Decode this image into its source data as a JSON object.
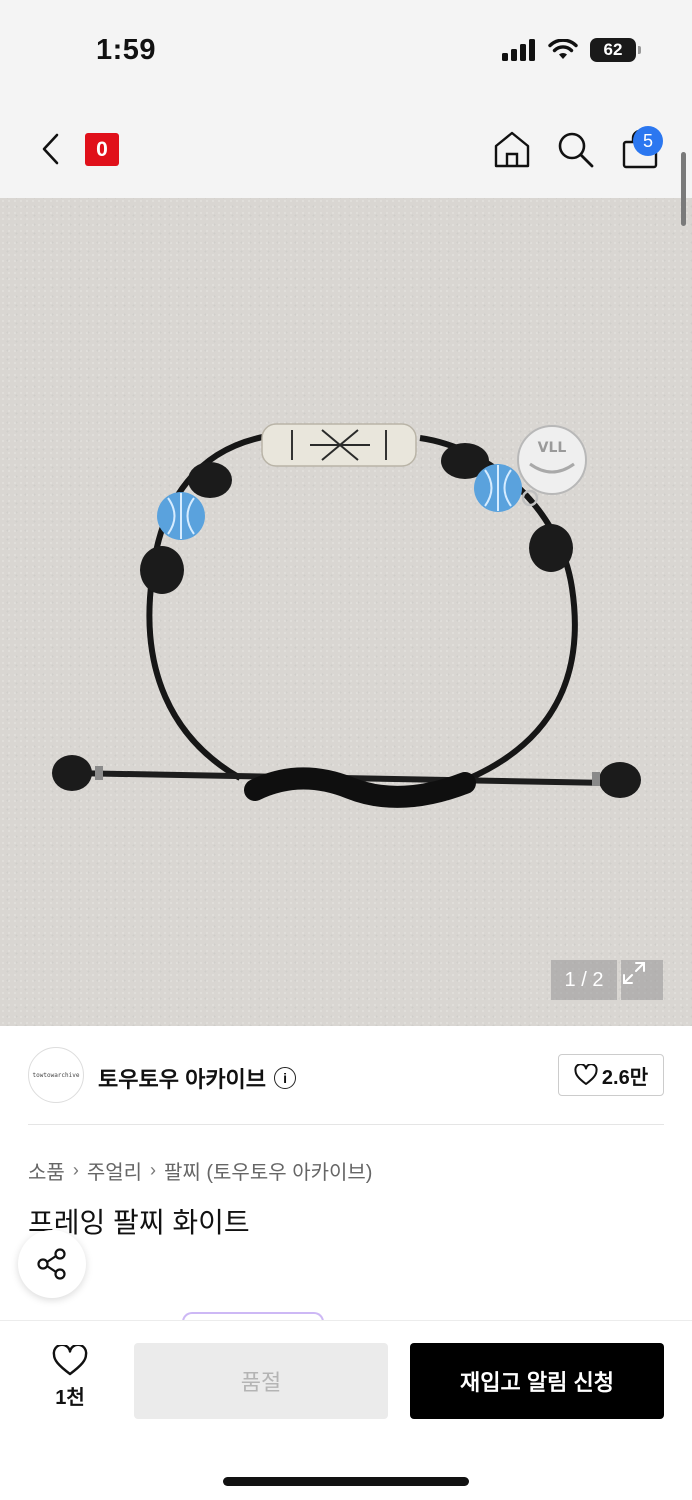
{
  "status_bar": {
    "time": "1:59",
    "battery": "62"
  },
  "header": {
    "logo_text": "0",
    "cart_count": "5"
  },
  "gallery": {
    "pager": "1 / 2",
    "bead_text": "VLL"
  },
  "brand": {
    "avatar_text": "towtowarchive",
    "name": "토우토우 아카이브",
    "likes": "2.6만"
  },
  "breadcrumb": {
    "items": [
      "소품",
      "주얼리",
      "팔찌 (토우토우 아카이브)"
    ]
  },
  "product": {
    "title": "프레잉 팔찌 화이트"
  },
  "bottom_bar": {
    "wish_count": "1천",
    "soldout_label": "품절",
    "restock_label": "재입고 알림 신청"
  },
  "colors": {
    "accent_red": "#e0101a",
    "badge_blue": "#2b77f0",
    "primary_button": "#000000",
    "disabled_button": "#ebebeb"
  }
}
